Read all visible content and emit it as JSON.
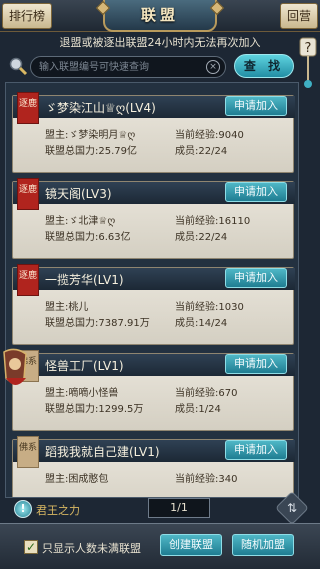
{
  "header": {
    "title": "联盟",
    "rank_label": "排行榜",
    "back_label": "回营"
  },
  "notice": "退盟或被逐出联盟24小时内无法再次加入",
  "search": {
    "placeholder": "输入联盟编号可快速查询",
    "button_label": "查 找",
    "clear_glyph": "×"
  },
  "alliances": [
    {
      "tag": "逐鹿",
      "name": "ゞ梦染江山♕ღ(LV4)",
      "leader": "盟主:ゞ梦染明月♕ღ",
      "exp": "当前经验:9040",
      "power": "联盟总国力:25.79亿",
      "members": "成员:22/24",
      "apply_label": "申请加入"
    },
    {
      "tag": "逐鹿",
      "name": "镜天阁(LV3)",
      "leader": "盟主:ゞ北津♕ღ",
      "exp": "当前经验:16110",
      "power": "联盟总国力:6.63亿",
      "members": "成员:22/24",
      "apply_label": "申请加入"
    },
    {
      "tag": "逐鹿",
      "name": "一揽芳华(LV1)",
      "leader": "盟主:桃儿",
      "exp": "当前经验:1030",
      "power": "联盟总国力:7387.91万",
      "members": "成员:14/24",
      "apply_label": "申请加入"
    },
    {
      "tag": "佛系",
      "name": "怪兽工厂(LV1)",
      "leader": "盟主:嘀嘀小怪兽",
      "exp": "当前经验:670",
      "power": "联盟总国力:1299.5万",
      "members": "成员:1/24",
      "apply_label": "申请加入"
    },
    {
      "tag": "佛系",
      "name": "蹈我我就自己建(LV1)",
      "leader": "盟主:困成憨包",
      "exp": "当前经验:340",
      "power": "",
      "members": "",
      "apply_label": "申请加入"
    }
  ],
  "footer": {
    "king_power_label": "君王之力",
    "page": "1/1",
    "checkbox_label": "只显示人数未满联盟",
    "checkbox_checked": true,
    "checkbox_mark": "✓",
    "create_label": "创建联盟",
    "random_label": "随机加盟",
    "sort_glyph": "⇅"
  },
  "colors": {
    "accent_teal": "#2a93a8",
    "tag_red": "#b0241e",
    "tag_tan": "#c7ad85"
  }
}
